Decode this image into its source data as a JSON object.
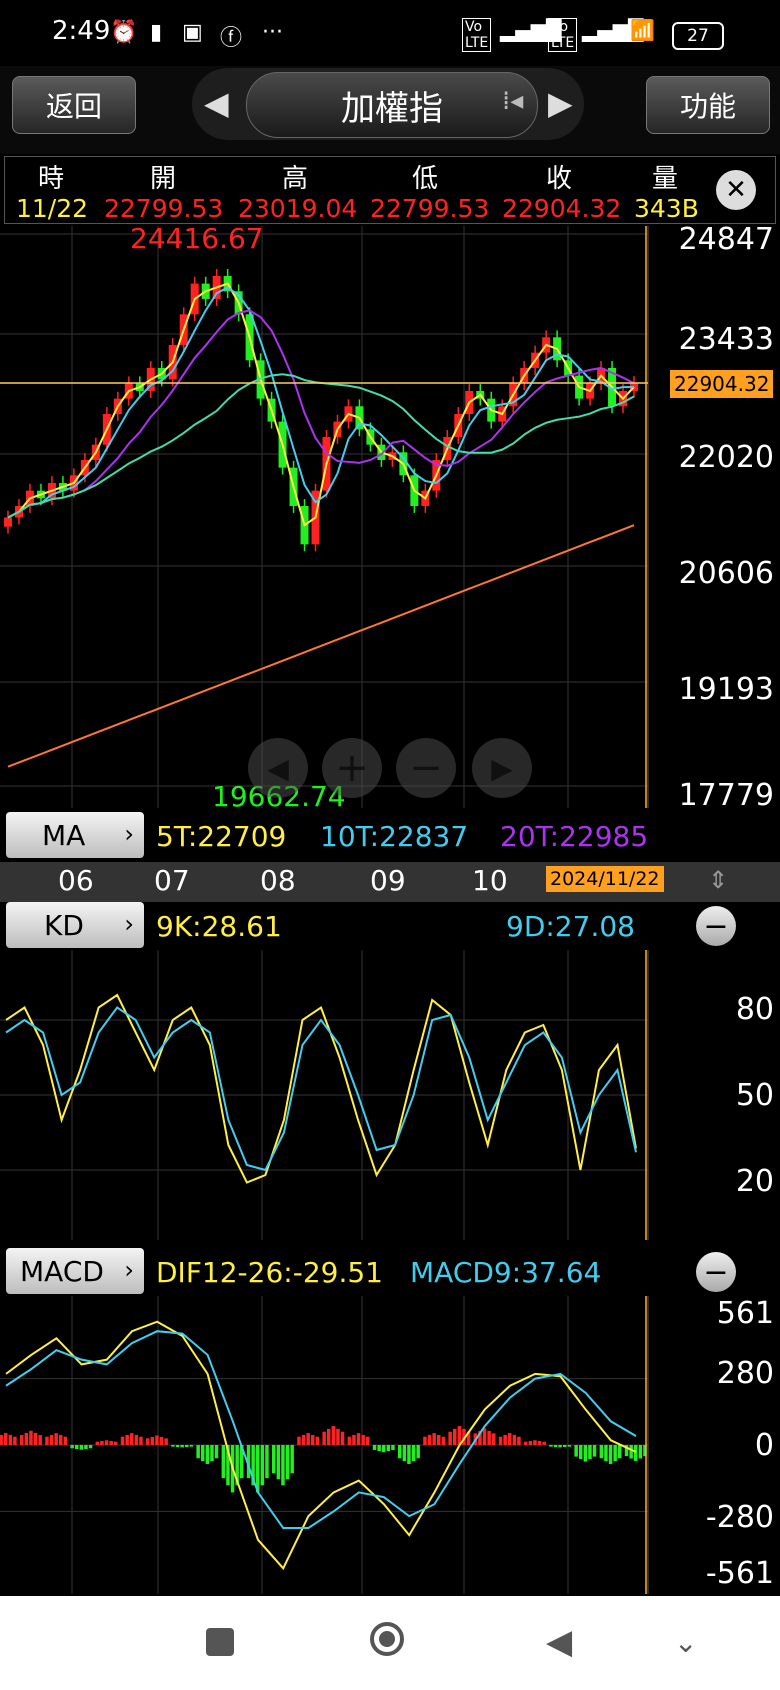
{
  "status_bar": {
    "time": "2:49",
    "battery": "27"
  },
  "header": {
    "back_label": "返回",
    "title": "加權指",
    "menu_label": "功能"
  },
  "quote": {
    "headers": [
      "時",
      "開",
      "高",
      "低",
      "收",
      "量"
    ],
    "values": [
      "11/22",
      "22799.53",
      "23019.04",
      "22799.53",
      "22904.32",
      "343B"
    ]
  },
  "main_chart": {
    "y_ticks": [
      "24847",
      "23433",
      "22020",
      "20606",
      "19193",
      "17779"
    ],
    "current_price": "22904.32",
    "high_label": "24416.67",
    "low_label": "19662.74",
    "x_ticks": [
      "06",
      "07",
      "08",
      "09",
      "10"
    ],
    "current_date": "2024/11/22",
    "ma_button": "MA",
    "ma_legend": [
      "5T:22709",
      "10T:22837",
      "20T:22985"
    ]
  },
  "kd_panel": {
    "button": "KD",
    "k_label": "9K:28.61",
    "d_label": "9D:27.08",
    "y_ticks": [
      "80",
      "50",
      "20"
    ]
  },
  "macd_panel": {
    "button": "MACD",
    "dif_label": "DIF12-26:-29.51",
    "macd_label": "MACD9:37.64",
    "y_ticks": [
      "561",
      "280",
      "0",
      "-280",
      "-561"
    ]
  },
  "colors": {
    "up": "#ff2222",
    "down": "#22ee22",
    "ma5": "#ffee44",
    "ma10": "#44ccee",
    "ma20": "#aa33ee",
    "ma60": "#44ddaa",
    "ma240": "#ff7733"
  },
  "chart_data": [
    {
      "type": "candlestick",
      "x_ticks": [
        "06",
        "07",
        "08",
        "09",
        "10"
      ],
      "ylim": [
        17779,
        24847
      ],
      "y_ticks": [
        24847,
        23433,
        22020,
        20606,
        19193,
        17779
      ],
      "close_series": [
        21150,
        21300,
        21500,
        21400,
        21600,
        21500,
        21700,
        21900,
        22100,
        22500,
        22700,
        22900,
        22800,
        23100,
        22950,
        23400,
        23800,
        24200,
        24000,
        24300,
        24100,
        23800,
        23200,
        22700,
        22400,
        21800,
        21300,
        20800,
        21500,
        22200,
        22400,
        22600,
        22300,
        22100,
        21900,
        22000,
        21700,
        21300,
        21500,
        21900,
        22200,
        22500,
        22800,
        22700,
        22400,
        22600,
        22900,
        23100,
        23300,
        23500,
        23200,
        23000,
        22700,
        22900,
        23100,
        22600,
        22800,
        22904.32
      ],
      "series": [
        {
          "name": "5T",
          "last": 22709
        },
        {
          "name": "10T",
          "last": 22837
        },
        {
          "name": "20T",
          "last": 22985
        }
      ]
    },
    {
      "type": "line",
      "name": "KD",
      "ylim": [
        0,
        100
      ],
      "y_ticks": [
        80,
        50,
        20
      ],
      "series": [
        {
          "name": "9K",
          "values": [
            80,
            85,
            70,
            40,
            60,
            85,
            90,
            75,
            60,
            80,
            85,
            70,
            30,
            15,
            18,
            40,
            80,
            85,
            65,
            40,
            18,
            30,
            60,
            88,
            82,
            55,
            30,
            60,
            75,
            78,
            60,
            20,
            60,
            70,
            28.61
          ]
        },
        {
          "name": "9D",
          "values": [
            75,
            80,
            75,
            50,
            55,
            75,
            85,
            80,
            65,
            75,
            80,
            75,
            40,
            22,
            20,
            35,
            70,
            80,
            70,
            50,
            28,
            30,
            50,
            80,
            82,
            65,
            40,
            55,
            70,
            75,
            65,
            35,
            50,
            60,
            27.08
          ]
        }
      ]
    },
    {
      "type": "bar+line",
      "name": "MACD",
      "ylim": [
        -561,
        561
      ],
      "y_ticks": [
        561,
        280,
        0,
        -280,
        -561
      ],
      "series": [
        {
          "name": "DIF12-26",
          "values": [
            300,
            380,
            450,
            340,
            360,
            480,
            520,
            460,
            300,
            -100,
            -400,
            -520,
            -300,
            -200,
            -150,
            -250,
            -380,
            -200,
            0,
            150,
            250,
            300,
            290,
            150,
            20,
            -29.51
          ]
        },
        {
          "name": "MACD9",
          "values": [
            250,
            320,
            400,
            360,
            340,
            430,
            480,
            470,
            380,
            100,
            -200,
            -350,
            -350,
            -280,
            -200,
            -220,
            -300,
            -250,
            -80,
            80,
            200,
            280,
            300,
            220,
            100,
            37.64
          ]
        },
        {
          "name": "OSC",
          "values": [
            50,
            60,
            50,
            -20,
            20,
            50,
            40,
            -10,
            -80,
            -200,
            -200,
            -170,
            50,
            80,
            50,
            -30,
            -80,
            50,
            80,
            70,
            50,
            20,
            -10,
            -70,
            -80,
            -67.15
          ]
        }
      ]
    }
  ]
}
